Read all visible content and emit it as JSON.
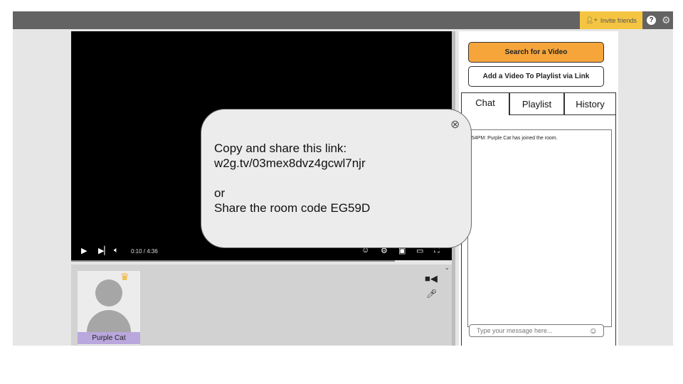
{
  "topbar": {
    "invite_label": "Invite friends",
    "help_icon": "help-icon",
    "settings_icon": "gear-icon"
  },
  "player": {
    "time": "0:10 / 4:36",
    "progress_fraction": 0.036
  },
  "webcam": {
    "user_name": "Purple Cat",
    "crown_icon": "crown-icon"
  },
  "sidebar": {
    "search_label": "Search for a Video",
    "add_label": "Add a Video To Playlist via Link",
    "tabs": [
      {
        "label": "Chat"
      },
      {
        "label": "Playlist"
      },
      {
        "label": "History"
      }
    ],
    "chat_messages": [
      ":54PM: Purple Cat has joined the room."
    ],
    "chat_placeholder": "Type your message here..."
  },
  "popup": {
    "line1": "Copy and share this link:",
    "link": "w2g.tv/03mex8dvz4gcwl7njr",
    "line3": "or",
    "line4": "Share the room code EG59D"
  },
  "colors": {
    "accent_orange": "#f6a53b",
    "invite_yellow": "#f5c542",
    "name_purple": "#b9a7dd"
  }
}
